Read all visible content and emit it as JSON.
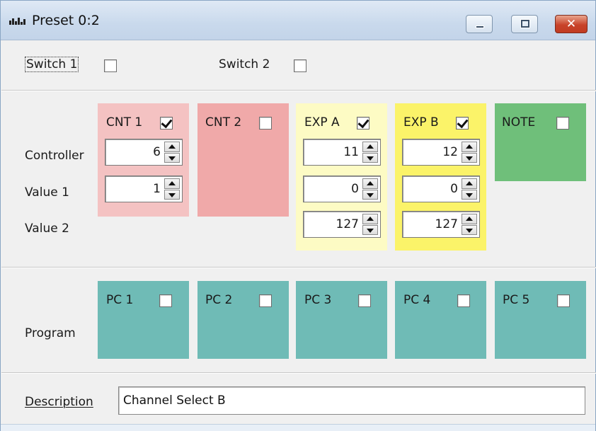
{
  "window": {
    "title": "Preset 0:2"
  },
  "switches": [
    {
      "label": "Switch 1",
      "checked": false
    },
    {
      "label": "Switch 2",
      "checked": false
    }
  ],
  "row_labels": {
    "controller": "Controller",
    "value1": "Value 1",
    "value2": "Value 2",
    "program": "Program",
    "description": "Description"
  },
  "controllers": [
    {
      "label": "CNT 1",
      "checked": true,
      "color": "#f4c2c2",
      "controller": "6",
      "value1": "1"
    },
    {
      "label": "CNT 2",
      "checked": false,
      "color": "#f0a9a9"
    },
    {
      "label": "EXP A",
      "checked": true,
      "color": "#fdfbc4",
      "controller": "11",
      "value1": "0",
      "value2": "127"
    },
    {
      "label": "EXP B",
      "checked": true,
      "color": "#fbf369",
      "controller": "12",
      "value1": "0",
      "value2": "127"
    },
    {
      "label": "NOTE",
      "checked": false,
      "color": "#6fbf7a"
    }
  ],
  "programs": [
    {
      "label": "PC 1",
      "checked": false
    },
    {
      "label": "PC 2",
      "checked": false
    },
    {
      "label": "PC 3",
      "checked": false
    },
    {
      "label": "PC 4",
      "checked": false
    },
    {
      "label": "PC 5",
      "checked": false
    }
  ],
  "program_color": "#6fbbb6",
  "description": {
    "value": "Channel Select B"
  }
}
